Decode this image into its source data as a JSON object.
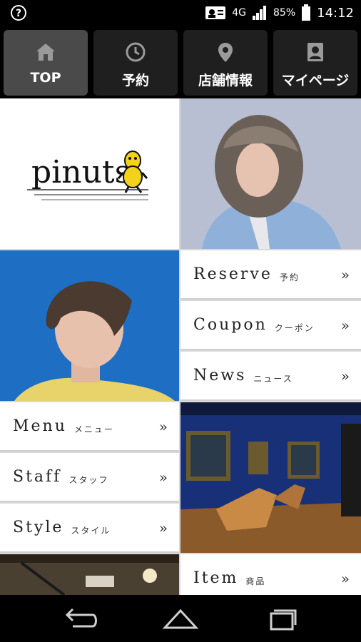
{
  "status": {
    "signal_label": "4G",
    "battery": "85%",
    "time": "14:12"
  },
  "nav": [
    {
      "label": "TOP",
      "icon": "home-icon"
    },
    {
      "label": "予約",
      "icon": "clock-icon"
    },
    {
      "label": "店舗情報",
      "icon": "location-pin-icon"
    },
    {
      "label": "マイページ",
      "icon": "person-card-icon"
    }
  ],
  "logo_text": "pinuts",
  "menu": {
    "reserve": {
      "en": "Reserve",
      "jp": "予約"
    },
    "coupon": {
      "en": "Coupon",
      "jp": "クーポン"
    },
    "news": {
      "en": "News",
      "jp": "ニュース"
    },
    "menu": {
      "en": "Menu",
      "jp": "メニュー"
    },
    "staff": {
      "en": "Staff",
      "jp": "スタッフ"
    },
    "style": {
      "en": "Style",
      "jp": "スタイル"
    },
    "item": {
      "en": "Item",
      "jp": "商品"
    },
    "arrow": "»"
  },
  "colors": {
    "accent_blue": "#1e6fc4",
    "nav_active": "#4a4a4a",
    "nav_bg": "#1f1f1f"
  }
}
